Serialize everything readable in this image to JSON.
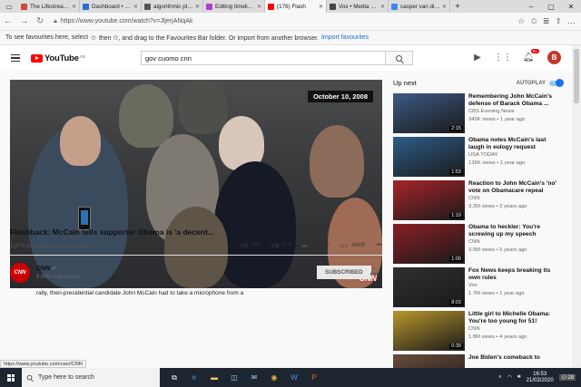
{
  "browser": {
    "tabs": [
      {
        "label": "The Lifestream of E",
        "color": "#d04a3b",
        "active": false
      },
      {
        "label": "Dashboard • The Li",
        "color": "#2a6fd1",
        "active": false
      },
      {
        "label": "algorithmic play – l",
        "color": "#555555",
        "active": false
      },
      {
        "label": "Editing timeline Alg",
        "color": "#b03ad0",
        "active": false
      },
      {
        "label": "(176) Flash",
        "color": "#ff0000",
        "active": true
      },
      {
        "label": "Vox • Media Bias/F",
        "color": "#444444",
        "active": false
      },
      {
        "label": "casper van dien - G",
        "color": "#4285f4",
        "active": false
      }
    ],
    "url": "https://www.youtube.com/watch?v=JljerjANqAk",
    "favourites_text": "To see favourites here, select",
    "favourites_text2": "then ✩, and drag to the Favourites Bar folder. Or import from another browser.",
    "favourites_link": "Import favourites"
  },
  "header": {
    "logo_text": "YouTube",
    "logo_region": "GB",
    "search_query": "gov cuomo cnn",
    "notification_count": "9+",
    "account_initial": "B"
  },
  "video": {
    "date_overlay": "October 10, 2008",
    "watermark": "CNN",
    "title": "Flashback: McCain tells supporter Obama is 'a decent...",
    "views_date": "1,874,434 views • Feb 19, 2015",
    "likes": "40K",
    "dislikes": "914",
    "share_label": "SHARE",
    "save_label": "SAVE",
    "more_label": "•••"
  },
  "channel": {
    "avatar_text": "CNN",
    "name": "CNN",
    "subscribers": "8.88M subscribers",
    "subscribe_label": "SUBSCRIBED",
    "description": "rally, then-presidential candidate John McCain had to take a microphone from a"
  },
  "status_url": "https://www.youtube.com/user/CNN",
  "up_next": {
    "heading": "Up next",
    "autoplay_label": "AUTOPLAY",
    "items": [
      {
        "title": "Remembering John McCain's defense of Barack Obama ...",
        "channel": "CBS Evening News",
        "meta": "345K views • 1 year ago",
        "duration": "2:15",
        "bg": "#3d5a86"
      },
      {
        "title": "Obama notes McCain's last laugh in eulogy request",
        "channel": "USA TODAY",
        "meta": "136K views • 1 year ago",
        "duration": "1:53",
        "bg": "#2d5d8a"
      },
      {
        "title": "Reaction to John McCain's 'no' vote on Obamacare repeal",
        "channel": "CNN",
        "meta": "3.2M views • 2 years ago",
        "duration": "1:19",
        "bg": "#a8242a"
      },
      {
        "title": "Obama to heckler: You're screwing up my speech",
        "channel": "CNN",
        "meta": "3.5M views • 5 years ago",
        "duration": "1:00",
        "bg": "#8a1f25"
      },
      {
        "title": "Fox News keeps breaking its own rules",
        "channel": "Vox",
        "meta": "1.7M views • 1 year ago",
        "duration": "8:03",
        "bg": "#2f2f2f"
      },
      {
        "title": "Little girl to Michelle Obama: You're too young for 51!",
        "channel": "CNN",
        "meta": "1.8M views • 4 years ago",
        "duration": "0:39",
        "bg": "#b9962c"
      },
      {
        "title": "Joe Biden's comeback to",
        "channel": "",
        "meta": "",
        "duration": "",
        "bg": "#6a4b3a"
      }
    ]
  },
  "taskbar": {
    "search_placeholder": "Type here to search",
    "time": "16:53",
    "date": "21/03/2020",
    "notif_count": "28"
  }
}
